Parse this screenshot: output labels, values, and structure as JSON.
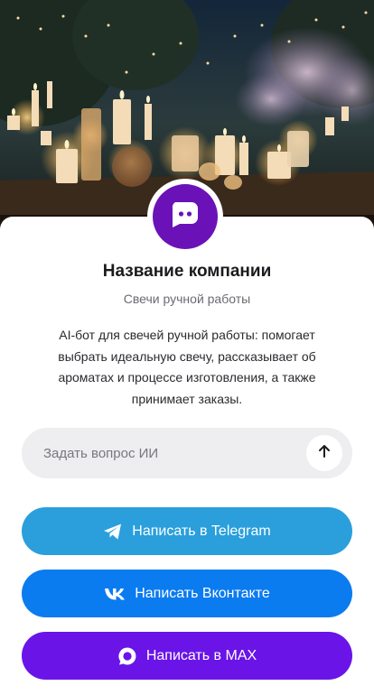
{
  "company": {
    "name": "Название компании",
    "subtitle": "Свечи ручной работы",
    "description": "AI-бот для свечей ручной работы: помогает выбрать идеальную свечу, рассказывает об ароматах и процессе изготовления, а также принимает заказы."
  },
  "ask": {
    "placeholder": "Задать вопрос ИИ",
    "send_icon": "arrow-up-icon"
  },
  "buttons": {
    "telegram": {
      "label": "Написать в Telegram",
      "icon": "telegram-icon",
      "color": "#2a9fdc"
    },
    "vk": {
      "label": "Написать Вконтакте",
      "icon": "vk-icon",
      "color": "#0b7bf0"
    },
    "max": {
      "label": "Написать в MAX",
      "icon": "max-icon",
      "color": "#6a14e8"
    }
  },
  "avatar": {
    "icon": "bot-icon",
    "color": "#6a12b8"
  }
}
